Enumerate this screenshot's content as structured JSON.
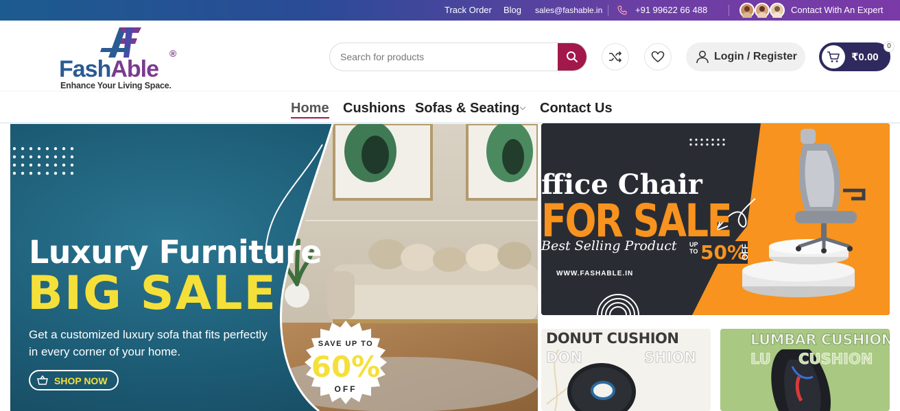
{
  "topbar": {
    "track_order": "Track Order",
    "blog": "Blog",
    "email": "sales@fashable.in",
    "phone": "+91 99622 66 488",
    "contact_expert": "Contact With An Expert"
  },
  "header": {
    "logo_text_part1": "Fash",
    "logo_text_part2": "Able",
    "logo_registered": "®",
    "logo_tagline": "Enhance Your Living Space.",
    "search_placeholder": "Search for products",
    "login_label": "Login / Register",
    "cart_total": "₹0.00",
    "cart_count": "0"
  },
  "nav": {
    "items": [
      "Home",
      "Cushions",
      "Sofas & Seating",
      "Contact Us"
    ],
    "active": "Home"
  },
  "hero": {
    "heading": "Luxury Furniture",
    "subheading": "BIG SALE",
    "description_line1": "Get a customized luxury sofa that fits perfectly",
    "description_line2": "in every corner of your home.",
    "cta_label": "SHOP NOW",
    "badge_top": "SAVE UP TO",
    "badge_value": "60%",
    "badge_bottom": "OFF"
  },
  "office_banner": {
    "title": "ffice Chair",
    "subtitle": "FOR SALE",
    "tagline": "Best Selling Product",
    "website": "WWW.FASHABLE.IN",
    "upto": "UP TO",
    "discount": "50%",
    "off": "OFF"
  },
  "donut_banner": {
    "title": "DONUT CUSHION",
    "echo_left": "DON",
    "echo_right": "SHION"
  },
  "lumbar_banner": {
    "title": "LUMBAR CUSHION",
    "echo_left": "LU",
    "echo_right": "CUSHION"
  },
  "colors": {
    "brand_primary": "#a3184b",
    "brand_dark": "#2e2a5e",
    "hero_bg": "#1f5e79",
    "hero_accent": "#f5e03a",
    "office_accent": "#f7931e"
  }
}
